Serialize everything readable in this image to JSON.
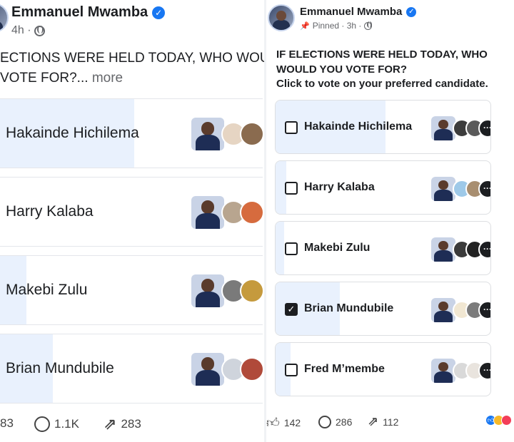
{
  "left": {
    "author": "Emmanuel Mwamba",
    "time": "4h ·",
    "question_line1": "ECTIONS WERE HELD TODAY, WHO WOUL",
    "question_line2": "VOTE FOR?...",
    "more": "more",
    "options": [
      {
        "label": "Hakainde Hichilema",
        "fill": 0.51
      },
      {
        "label": "Harry Kalaba",
        "fill": 0.0
      },
      {
        "label": "Makebi Zulu",
        "fill": 0.1
      },
      {
        "label": "Brian Mundubile",
        "fill": 0.2
      }
    ],
    "footer": {
      "likes": "83",
      "comments": "1.1K",
      "shares": "283"
    }
  },
  "right": {
    "author": "Emmanuel Mwamba",
    "meta": "Pinned · 3h ·",
    "question_line1": "IF ELECTIONS WERE HELD TODAY, WHO",
    "question_line2": "WOULD YOU VOTE FOR?",
    "question_line3": "Click to vote on your preferred candidate.",
    "options": [
      {
        "label": "Hakainde Hichilema",
        "fill": 0.51,
        "checked": false
      },
      {
        "label": "Harry Kalaba",
        "fill": 0.05,
        "checked": false
      },
      {
        "label": "Makebi Zulu",
        "fill": 0.04,
        "checked": false
      },
      {
        "label": "Brian Mundubile",
        "fill": 0.3,
        "checked": true
      },
      {
        "label": "Fred M’membe",
        "fill": 0.07,
        "checked": false
      }
    ],
    "footer": {
      "likes": "142",
      "comments": "286",
      "shares": "112"
    }
  },
  "icons": {
    "verified": "verified-badge-icon",
    "globe": "globe-icon",
    "pin": "pin-icon",
    "like": "like-icon",
    "comment": "comment-icon",
    "share": "share-icon",
    "more_faces": "more-dots-icon"
  },
  "colors": {
    "accent": "#1877f2",
    "fill": "#e9f1fd",
    "text": "#1c1e21",
    "muted": "#65676b"
  }
}
